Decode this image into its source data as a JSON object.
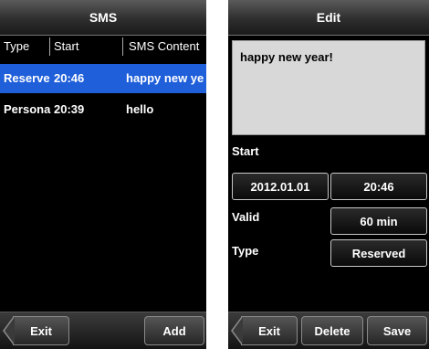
{
  "sms_list": {
    "title": "SMS",
    "columns": [
      "Type",
      "Start",
      "SMS Content"
    ],
    "rows": [
      {
        "type": "Reserve",
        "start": "20:46",
        "content": "happy new ye"
      },
      {
        "type": "Persona",
        "start": "20:39",
        "content": "hello"
      }
    ],
    "buttons": {
      "exit": "Exit",
      "add": "Add"
    }
  },
  "edit": {
    "title": "Edit",
    "message": "happy new year!",
    "start_label": "Start",
    "start_date": "2012.01.01",
    "start_time": "20:46",
    "valid_label": "Valid",
    "valid_value": "60 min",
    "type_label": "Type",
    "type_value": "Reserved",
    "buttons": {
      "exit": "Exit",
      "delete": "Delete",
      "save": "Save"
    }
  },
  "colors": {
    "selected_row": "#1f5fd9",
    "background": "#000000",
    "message_box": "#d8d8d8"
  }
}
